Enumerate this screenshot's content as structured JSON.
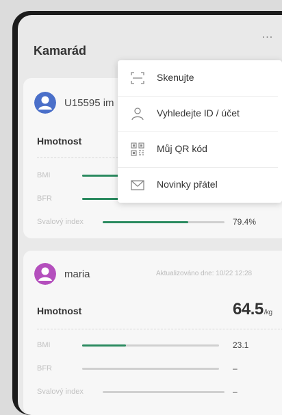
{
  "header": {
    "title": "Kamarád",
    "more_label": "..."
  },
  "menu": {
    "items": [
      {
        "label": "Skenujte",
        "icon": "scan-icon"
      },
      {
        "label": "Vyhledejte ID / účet",
        "icon": "person-icon"
      },
      {
        "label": "Můj QR kód",
        "icon": "qr-code-icon"
      },
      {
        "label": "Novinky přátel",
        "icon": "mail-icon"
      }
    ]
  },
  "cards": [
    {
      "username": "U15595 im",
      "avatar_color": "#4a6fc9",
      "weight_label": "Hmotnost",
      "metrics": [
        {
          "label": "BMI",
          "progress": 0.45
        },
        {
          "label": "BFR",
          "progress": 0.3
        },
        {
          "label": "Svalový index",
          "value": "79.4%",
          "progress": 0.7
        }
      ]
    },
    {
      "username": "maria",
      "avatar_color": "#b44fbd",
      "updated": "Aktualizováno dne: 10/22 12:28",
      "weight_label": "Hmotnost",
      "weight_value": "64.5",
      "weight_unit": "/kg",
      "metrics": [
        {
          "label": "BMI",
          "value": "23.1",
          "progress": 0.32
        },
        {
          "label": "BFR",
          "value": "–",
          "progress": 0
        },
        {
          "label": "Svalový index",
          "value": "–",
          "progress": 0
        }
      ]
    }
  ],
  "colors": {
    "accent": "#2a8a5f",
    "track": "#d0d0d0",
    "background": "#e9e9e9"
  }
}
